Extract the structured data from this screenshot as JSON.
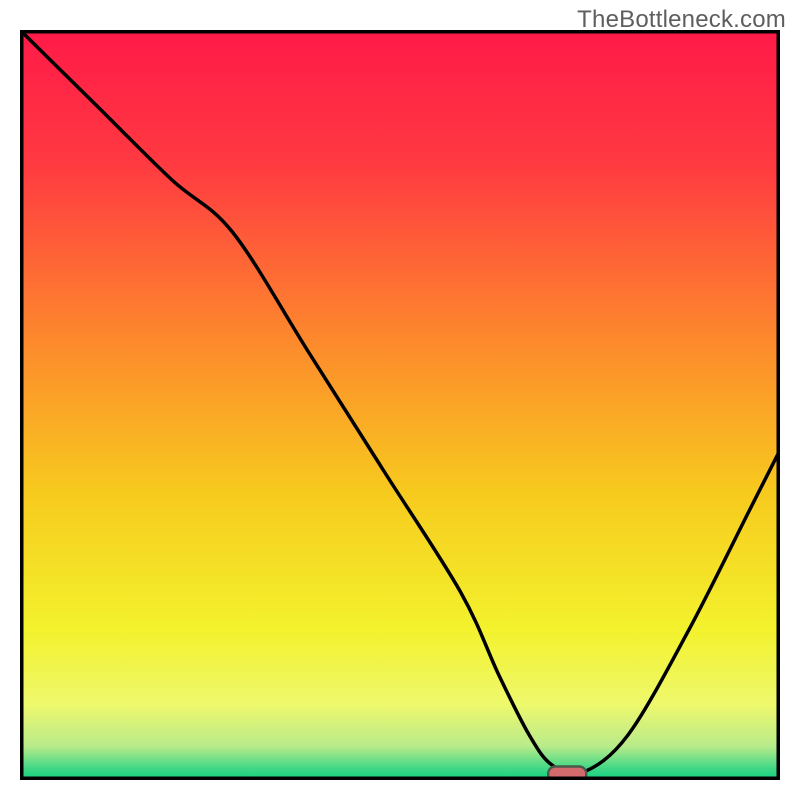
{
  "watermark": "TheBottleneck.com",
  "chart_data": {
    "type": "line",
    "title": "",
    "xlabel": "",
    "ylabel": "",
    "xlim": [
      0,
      100
    ],
    "ylim": [
      0,
      100
    ],
    "grid": false,
    "series": [
      {
        "name": "bottleneck-curve",
        "x": [
          0,
          10,
          20,
          28,
          38,
          48,
          58,
          63,
          67,
          70,
          74,
          80,
          88,
          96,
          100
        ],
        "y": [
          100,
          90,
          80,
          73,
          57,
          41,
          25,
          14,
          6,
          2,
          1,
          6,
          20,
          36,
          44
        ]
      }
    ],
    "annotations": [
      {
        "name": "optimal-marker",
        "x": 72,
        "y": 0.8
      }
    ],
    "background_gradient": {
      "stops": [
        {
          "offset": 0.0,
          "color": "#ff1a48"
        },
        {
          "offset": 0.18,
          "color": "#ff3a41"
        },
        {
          "offset": 0.42,
          "color": "#fd8b2c"
        },
        {
          "offset": 0.62,
          "color": "#f7cb1e"
        },
        {
          "offset": 0.8,
          "color": "#f3f22d"
        },
        {
          "offset": 0.9,
          "color": "#eef86d"
        },
        {
          "offset": 0.955,
          "color": "#b8eb8a"
        },
        {
          "offset": 0.985,
          "color": "#3fd786"
        },
        {
          "offset": 1.0,
          "color": "#0fd07e"
        }
      ]
    }
  }
}
